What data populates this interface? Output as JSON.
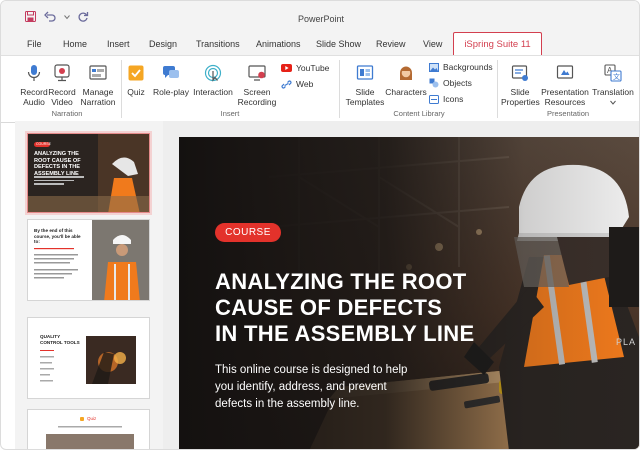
{
  "window": {
    "title": "PowerPoint"
  },
  "tabs": [
    "File",
    "Home",
    "Insert",
    "Design",
    "Transitions",
    "Animations",
    "Slide Show",
    "Review",
    "View"
  ],
  "active_tab": "iSpring Suite 11",
  "ribbon": {
    "narration": {
      "group_label": "Narration",
      "record_audio": [
        "Record",
        "Audio"
      ],
      "record_video": [
        "Record",
        "Video"
      ],
      "manage_narration": [
        "Manage",
        "Narration"
      ]
    },
    "insert": {
      "group_label": "Insert",
      "quiz": "Quiz",
      "roleplay": "Role-play",
      "interaction": "Interaction",
      "screen_recording": [
        "Screen",
        "Recording"
      ],
      "youtube": "YouTube",
      "web": "Web"
    },
    "content_library": {
      "group_label": "Content Library",
      "slide_templates": [
        "Slide",
        "Templates"
      ],
      "characters": "Characters",
      "backgrounds": "Backgrounds",
      "objects": "Objects",
      "icons": "Icons"
    },
    "presentation": {
      "group_label": "Presentation",
      "slide_properties": [
        "Slide",
        "Properties"
      ],
      "presentation_resources": [
        "Presentation",
        "Resources"
      ],
      "translation": "Translation"
    }
  },
  "thumbnails": [
    {
      "pill": "COURSE",
      "title": "ANALYZING THE ROOT CAUSE OF DEFECTS IN THE ASSEMBLY LINE"
    },
    {
      "title": "By the end of this course, you'll be able to:"
    },
    {
      "title": "QUALITY CONTROL TOOLS"
    },
    {
      "label": "Quiz"
    }
  ],
  "slide": {
    "pill": "COURSE",
    "title_lines": [
      "ANALYZING THE ROOT",
      "CAUSE OF DEFECTS",
      "IN THE ASSEMBLY LINE"
    ],
    "subtitle_lines": [
      "This online course is designed to help",
      "you identify, address, and prevent",
      "defects in the assembly line."
    ],
    "helmet_text": "PLA"
  },
  "colors": {
    "accent": "#d33f4f",
    "pill": "#e3322b",
    "vest": "#f07a1c"
  }
}
